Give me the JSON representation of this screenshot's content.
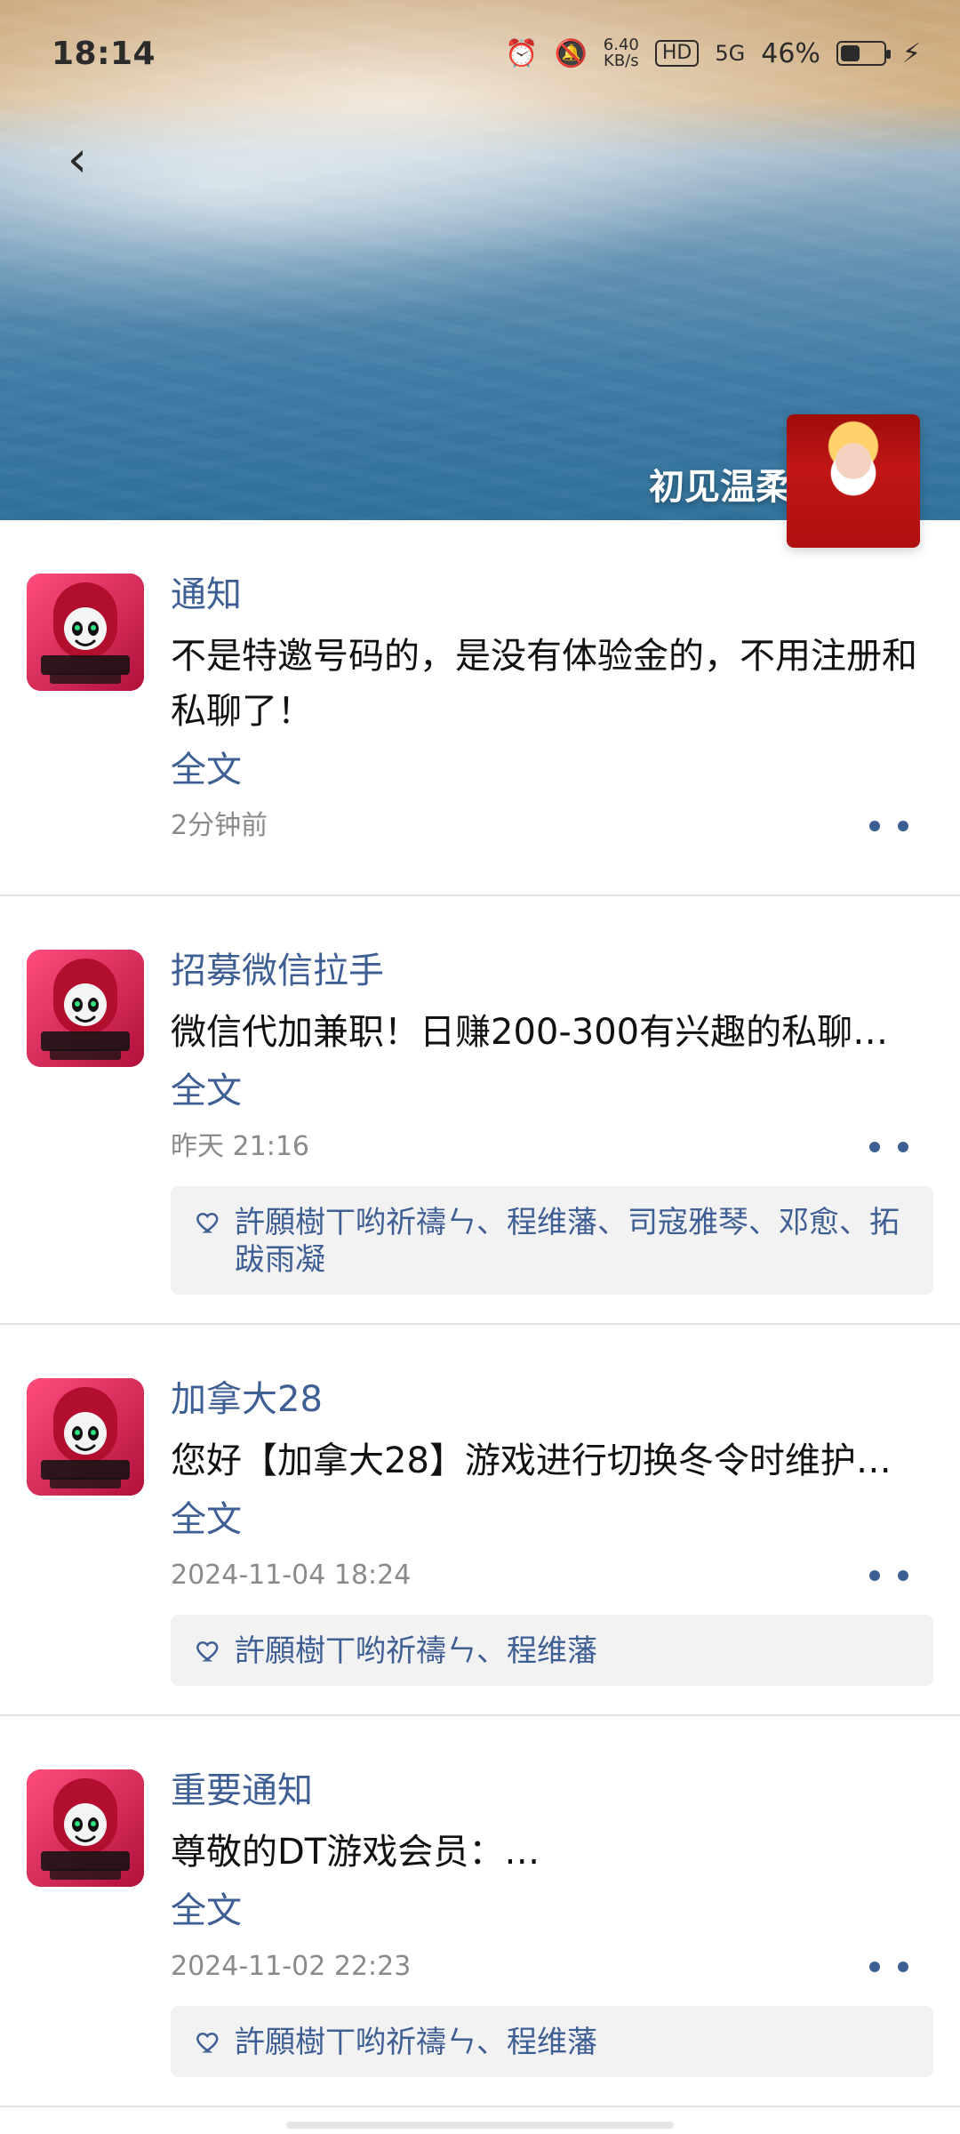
{
  "status_bar": {
    "time": "18:14",
    "net_speed_top": "6.40",
    "net_speed_bottom": "KB/s",
    "hd": "HD",
    "signal": "5G",
    "battery_percent": "46%",
    "battery_level": 0.46,
    "icons": [
      "alarm-icon",
      "mute-icon",
      "network-speed",
      "hd-icon",
      "5g-signal-icon",
      "battery-icon",
      "charging-icon"
    ]
  },
  "header": {
    "back_icon": "chevron-left-icon",
    "profile_name": "初见温柔"
  },
  "posts": [
    {
      "title": "通知",
      "content": "不是特邀号码的，是没有体验金的，不用注册和私聊了！",
      "fulltext_label": "全文",
      "time": "2分钟前"
    },
    {
      "title": "招募微信拉手",
      "content": "微信代加兼职！日赚200-300有兴趣的私聊…",
      "fulltext_label": "全文",
      "time": "昨天 21:16",
      "likes": "許願樹丅哟祈禱ㄣ、程维藩、司寇雅琴、邓愈、拓跋雨凝"
    },
    {
      "title": "加拿大28",
      "content": "您好【加拿大28】游戏进行切换冬令时维护…",
      "fulltext_label": "全文",
      "time": "2024-11-04 18:24",
      "likes": "許願樹丅哟祈禱ㄣ、程维藩"
    },
    {
      "title": "重要通知",
      "content": "尊敬的DT游戏会员：…",
      "fulltext_label": "全文",
      "time": "2024-11-02 22:23",
      "likes": "許願樹丅哟祈禱ㄣ、程维藩"
    }
  ],
  "colors": {
    "link_blue": "#3e5f93",
    "meta_gray": "#8a8a8a",
    "likes_bg": "#f2f2f2",
    "divider": "#e3e3e3"
  }
}
